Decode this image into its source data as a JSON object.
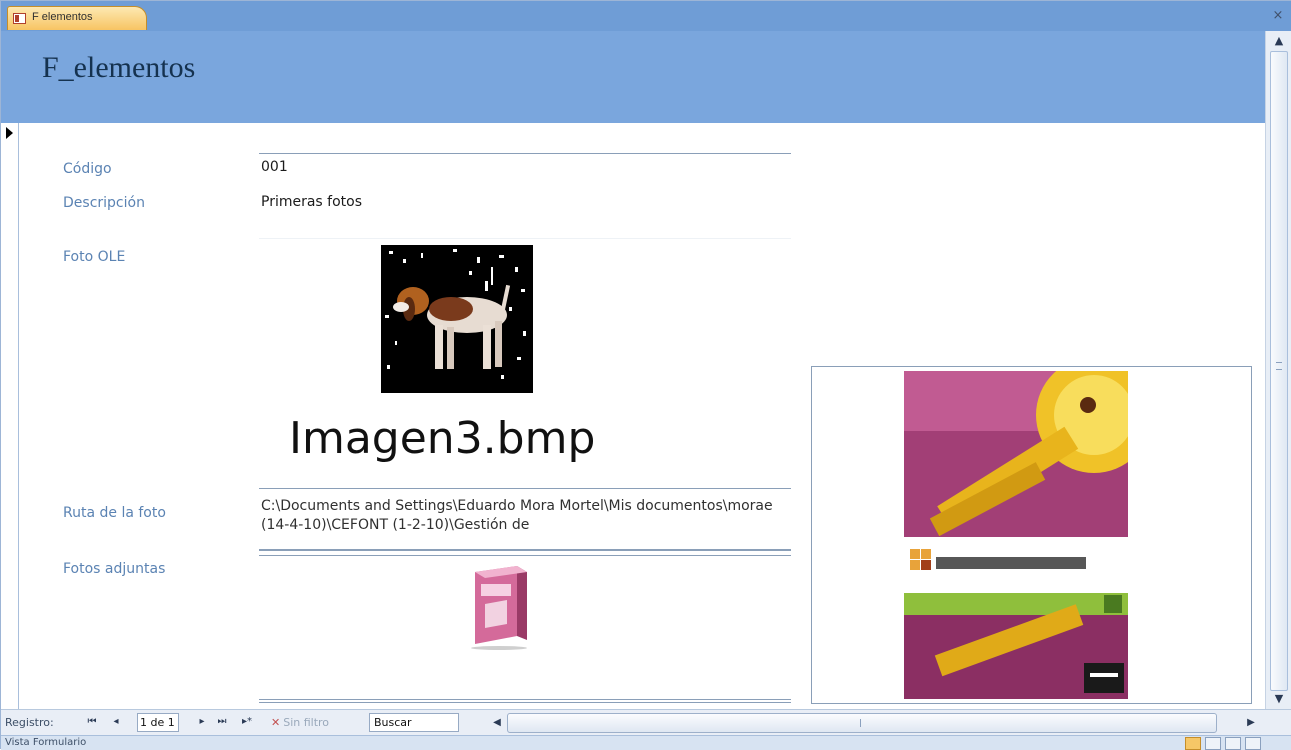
{
  "window": {
    "tab_label": "F elementos",
    "close_glyph": "×"
  },
  "form": {
    "title": "F_elementos"
  },
  "fields": {
    "codigo_label": "Código",
    "codigo_value": "001",
    "descripcion_label": "Descripción",
    "descripcion_value": "Primeras fotos",
    "foto_ole_label": "Foto OLE",
    "foto_ole_caption": "Imagen3.bmp",
    "ruta_label": "Ruta de la foto",
    "ruta_value": "C:\\Documents and Settings\\Eduardo Mora Mortel\\Mis documentos\\morae (14-4-10)\\CEFONT (1-2-10)\\Gestión de",
    "adjuntas_label": "Fotos adjuntas"
  },
  "navigation": {
    "registro_label": "Registro:",
    "first_glyph": "⏮",
    "prev_glyph": "◂",
    "record_position": "1 de 1",
    "next_glyph": "▸",
    "last_glyph": "⏭",
    "new_glyph": "▸*",
    "filter_label": "Sin filtro",
    "filter_glyph": "✕",
    "search_value": "Buscar",
    "scroll_left_glyph": "◀",
    "scroll_right_glyph": "▶"
  },
  "scrollbar": {
    "up_glyph": "▲",
    "down_glyph": "▼"
  },
  "status": {
    "text": "Vista Formulario"
  },
  "icons": {
    "record_selector": "current-record-arrow-icon",
    "tab": "form-icon"
  },
  "colors": {
    "header_blue": "#7aa6dd",
    "tab_orange": "#f7c463",
    "label_blue": "#5b83b3"
  }
}
